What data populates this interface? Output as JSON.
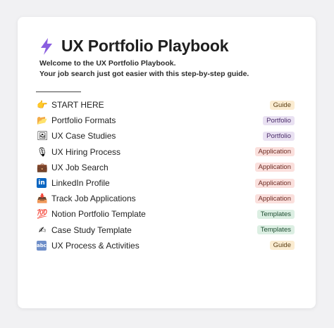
{
  "page": {
    "title": "UX Portfolio Playbook",
    "title_icon": "lightning-bolt-icon",
    "intro_line1": "Welcome to the UX Portfolio Playbook.",
    "intro_line2": "Your job search just got easier with this step-by-step guide."
  },
  "items": [
    {
      "emoji": "👉",
      "icon": "pointing-hand-icon",
      "label": "START HERE",
      "tag": "Guide",
      "tag_type": "guide"
    },
    {
      "emoji": "📂",
      "icon": "folder-icon",
      "label": "Portfolio Formats",
      "tag": "Portfolio",
      "tag_type": "portfolio"
    },
    {
      "emoji": "🖼",
      "icon": "framed-picture-icon",
      "label": "UX Case Studies",
      "tag": "Portfolio",
      "tag_type": "portfolio"
    },
    {
      "emoji": "🎙",
      "icon": "microphone-icon",
      "label": "UX Hiring Process",
      "tag": "Application",
      "tag_type": "application"
    },
    {
      "emoji": "💼",
      "icon": "briefcase-icon",
      "label": "UX Job Search",
      "tag": "Application",
      "tag_type": "application"
    },
    {
      "emoji": "in",
      "icon": "linkedin-icon",
      "label": "LinkedIn Profile",
      "tag": "Application",
      "tag_type": "application"
    },
    {
      "emoji": "📥",
      "icon": "inbox-tray-icon",
      "label": "Track Job Applications",
      "tag": "Application",
      "tag_type": "application"
    },
    {
      "emoji": "💯",
      "icon": "hundred-points-icon",
      "label": "Notion Portfolio Template",
      "tag": "Templates",
      "tag_type": "templates"
    },
    {
      "emoji": "✍",
      "icon": "writing-hand-icon",
      "label": "Case Study Template",
      "tag": "Templates",
      "tag_type": "templates"
    },
    {
      "emoji": "abc",
      "icon": "abc-input-icon",
      "label": "UX Process & Activities",
      "tag": "Guide",
      "tag_type": "guide"
    }
  ]
}
